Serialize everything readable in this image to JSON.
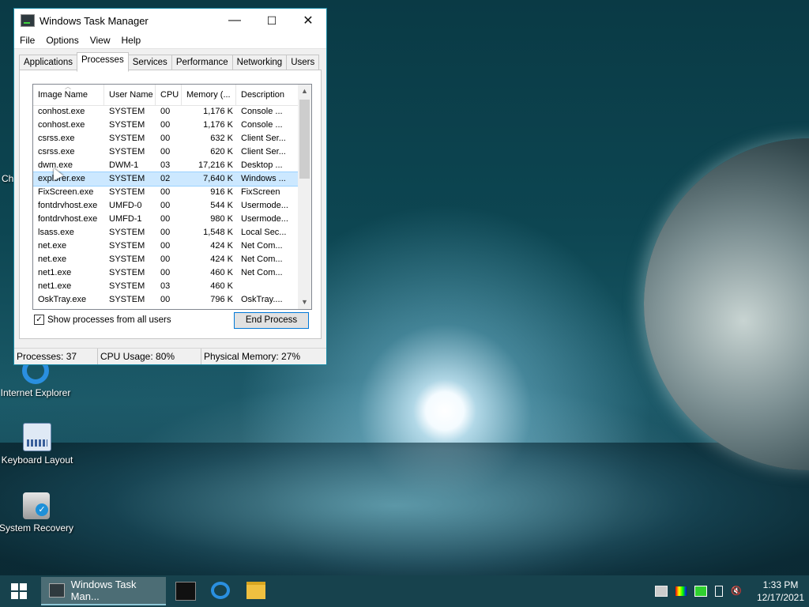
{
  "desktop": {
    "icons": [
      {
        "label": "Internet Explorer"
      },
      {
        "label": "Keyboard Layout"
      },
      {
        "label": "System Recovery"
      }
    ],
    "partial_label": "Ch"
  },
  "window": {
    "title": "Windows Task Manager",
    "controls": {
      "minimize": "—",
      "maximize": "☐",
      "close": "✕"
    },
    "menu": [
      "File",
      "Options",
      "View",
      "Help"
    ],
    "tabs": [
      "Applications",
      "Processes",
      "Services",
      "Performance",
      "Networking",
      "Users"
    ],
    "active_tab": "Processes",
    "columns": [
      "Image Name",
      "User Name",
      "CPU",
      "Memory (...",
      "Description"
    ],
    "rows": [
      [
        "conhost.exe",
        "SYSTEM",
        "00",
        "1,176 K",
        "Console ..."
      ],
      [
        "conhost.exe",
        "SYSTEM",
        "00",
        "1,176 K",
        "Console ..."
      ],
      [
        "csrss.exe",
        "SYSTEM",
        "00",
        "632 K",
        "Client Ser..."
      ],
      [
        "csrss.exe",
        "SYSTEM",
        "00",
        "620 K",
        "Client Ser..."
      ],
      [
        "dwm.exe",
        "DWM-1",
        "03",
        "17,216 K",
        "Desktop ..."
      ],
      [
        "explorer.exe",
        "SYSTEM",
        "02",
        "7,640 K",
        "Windows ..."
      ],
      [
        "FixScreen.exe",
        "SYSTEM",
        "00",
        "916 K",
        "FixScreen"
      ],
      [
        "fontdrvhost.exe",
        "UMFD-0",
        "00",
        "544 K",
        "Usermode..."
      ],
      [
        "fontdrvhost.exe",
        "UMFD-1",
        "00",
        "980 K",
        "Usermode..."
      ],
      [
        "lsass.exe",
        "SYSTEM",
        "00",
        "1,548 K",
        "Local Sec..."
      ],
      [
        "net.exe",
        "SYSTEM",
        "00",
        "424 K",
        "Net Com..."
      ],
      [
        "net.exe",
        "SYSTEM",
        "00",
        "424 K",
        "Net Com..."
      ],
      [
        "net1.exe",
        "SYSTEM",
        "00",
        "460 K",
        "Net Com..."
      ],
      [
        "net1.exe",
        "SYSTEM",
        "03",
        "460 K",
        ""
      ],
      [
        "OskTray.exe",
        "SYSTEM",
        "00",
        "796 K",
        "OskTray...."
      ]
    ],
    "selected_row": 5,
    "show_all_label": "Show processes from all users",
    "show_all_checked": true,
    "end_process_label": "End Process",
    "status": {
      "processes": "Processes: 37",
      "cpu": "CPU Usage: 80%",
      "memory": "Physical Memory: 27%"
    }
  },
  "taskbar": {
    "active_task": "Windows Task Man...",
    "clock_time": "1:33 PM",
    "clock_date": "12/17/2021",
    "pinned_icons": [
      "cmd-icon",
      "internet-explorer-icon",
      "file-explorer-icon"
    ],
    "tray_icons": [
      "keyboard-icon",
      "color-icon",
      "battery-icon",
      "usb-icon",
      "volume-muted-icon"
    ]
  },
  "colors": {
    "titlebar_border": "#1a8aa6",
    "taskbar_bg": "#17424d",
    "selection": "#cce8ff"
  }
}
